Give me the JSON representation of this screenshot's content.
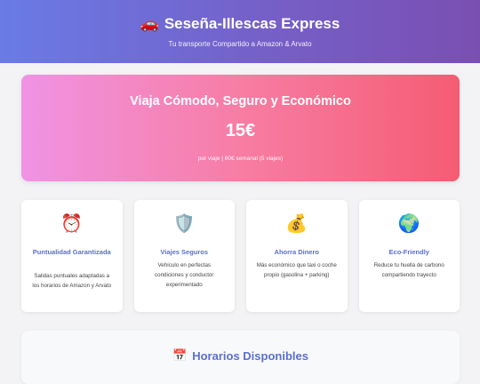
{
  "header": {
    "title": "Seseña-Illescas Express",
    "subtitle": "Tu transporte Compartido a Amazon & Arvato",
    "title_icon": "🚗"
  },
  "hero": {
    "title": "Viaja Cómodo, Seguro y Económico",
    "price": "15€",
    "detail": "por viaje | 60€ semanal (5 viajes)"
  },
  "features": [
    {
      "icon": "⏰",
      "icon_name": "alarm-clock-icon",
      "title": "Puntualidad Garantizada",
      "desc": "Salidas puntuales adaptadas a los horarios de Amazon y Arvato"
    },
    {
      "icon": "🛡️",
      "icon_name": "shield-icon",
      "title": "Viajes Seguros",
      "desc": "Vehículo en perfectas condiciones y conductor experimentado"
    },
    {
      "icon": "💰",
      "icon_name": "money-bag-icon",
      "title": "Ahorra Dinero",
      "desc": "Más económico que taxi o coche propio (gasolina + parking)"
    },
    {
      "icon": "🌍",
      "icon_name": "globe-icon",
      "title": "Eco-Friendly",
      "desc": "Reduce tu huella de carbono compartiendo trayecto"
    }
  ],
  "schedule": {
    "icon": "📅",
    "title": "Horarios Disponibles"
  }
}
